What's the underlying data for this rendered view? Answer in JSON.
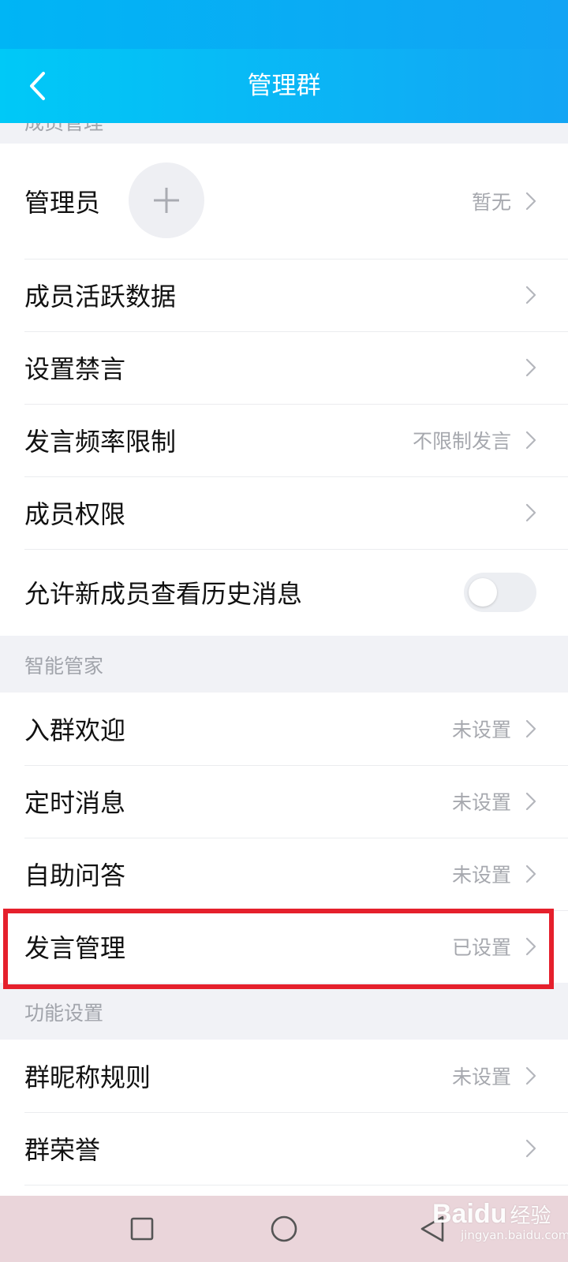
{
  "header": {
    "title": "管理群",
    "back_icon": "chevron-left-icon"
  },
  "sections": {
    "member_management": {
      "header": "成员管理",
      "admin": {
        "label": "管理员",
        "value": "暂无",
        "add_icon": "plus-icon"
      },
      "activity": {
        "label": "成员活跃数据"
      },
      "mute": {
        "label": "设置禁言"
      },
      "rate_limit": {
        "label": "发言频率限制",
        "value": "不限制发言"
      },
      "permissions": {
        "label": "成员权限"
      },
      "history": {
        "label": "允许新成员查看历史消息",
        "toggle_on": false
      }
    },
    "smart_butler": {
      "header": "智能管家",
      "welcome": {
        "label": "入群欢迎",
        "value": "未设置"
      },
      "scheduled": {
        "label": "定时消息",
        "value": "未设置"
      },
      "qa": {
        "label": "自助问答",
        "value": "未设置"
      },
      "speech": {
        "label": "发言管理",
        "value": "已设置"
      }
    },
    "feature_settings": {
      "header": "功能设置",
      "nickname_rules": {
        "label": "群昵称规则",
        "value": "未设置"
      },
      "honor": {
        "label": "群荣誉"
      }
    }
  },
  "highlight_color": "#e5202c",
  "accent_color": "#12a4f4",
  "nav": {
    "recent_icon": "square-icon",
    "home_icon": "circle-icon",
    "back_icon": "triangle-back-icon"
  },
  "watermark": {
    "brand": "Baidu",
    "suffix": "经验",
    "url": "jingyan.baidu.com"
  }
}
